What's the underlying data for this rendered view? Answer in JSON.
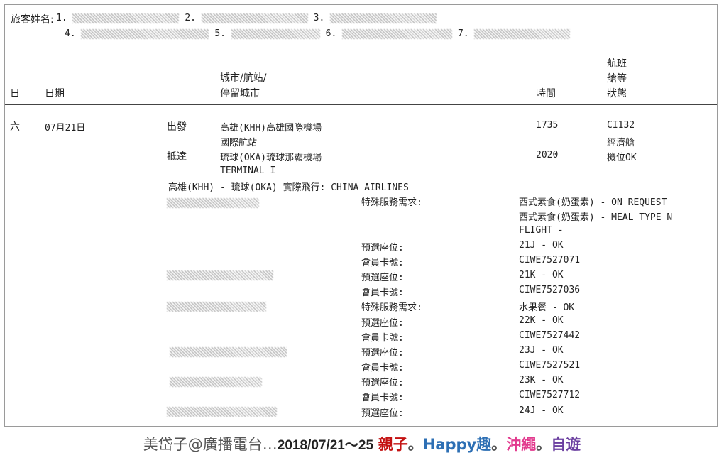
{
  "passengers": {
    "label": "旅客姓名:",
    "numbers": [
      "1.",
      "2.",
      "3.",
      "4.",
      "5.",
      "6.",
      "7."
    ]
  },
  "table_headers": {
    "day": "日",
    "date": "日期",
    "city_line1": "城市/航站/",
    "city_line2": "停留城市",
    "time": "時間",
    "flight_line1": "航班",
    "flight_line2": "艙等",
    "flight_line3": "狀態"
  },
  "segment": {
    "day": "六",
    "date": "07月21日",
    "depart_label": "出發",
    "depart_city": "高雄(KHH)高雄國際機場",
    "depart_terminal": "國際航站",
    "depart_time": "1735",
    "arrive_label": "抵達",
    "arrive_city": "琉球(OKA)琉球那霸機場",
    "arrive_terminal": "TERMINAL I",
    "arrive_time": "2020",
    "flight_no": "CI132",
    "cabin": "經濟艙",
    "status": "機位OK",
    "route_summary": "高雄(KHH) - 琉球(OKA) 實際飛行: CHINA AIRLINES"
  },
  "services": [
    {
      "label": "特殊服務需求:",
      "value": "西式素食(奶蛋素) - ON REQUEST"
    },
    {
      "label": "",
      "value": "西式素食(奶蛋素) - MEAL TYPE N"
    },
    {
      "label": "",
      "value": "FLIGHT -"
    },
    {
      "label": "預選座位:",
      "value": "21J - OK"
    },
    {
      "label": "會員卡號:",
      "value": "CIWE7527071"
    },
    {
      "label": "預選座位:",
      "value": "21K - OK"
    },
    {
      "label": "會員卡號:",
      "value": "CIWE7527036"
    },
    {
      "label": "特殊服務需求:",
      "value": "水果餐 - OK"
    },
    {
      "label": "預選座位:",
      "value": "22K - OK"
    },
    {
      "label": "會員卡號:",
      "value": "CIWE7527442"
    },
    {
      "label": "預選座位:",
      "value": "23J - OK"
    },
    {
      "label": "會員卡號:",
      "value": "CIWE7527521"
    },
    {
      "label": "預選座位:",
      "value": "23K - OK"
    },
    {
      "label": "會員卡號:",
      "value": "CIWE7527712"
    },
    {
      "label": "預選座位:",
      "value": "24J - OK"
    }
  ],
  "caption": {
    "author": "美岱子@廣播電台…",
    "date": "2018/07/21〜25",
    "w1": "親子",
    "dot": "。",
    "w2": "Happy趣",
    "w3": "沖繩",
    "w4": "自遊"
  }
}
